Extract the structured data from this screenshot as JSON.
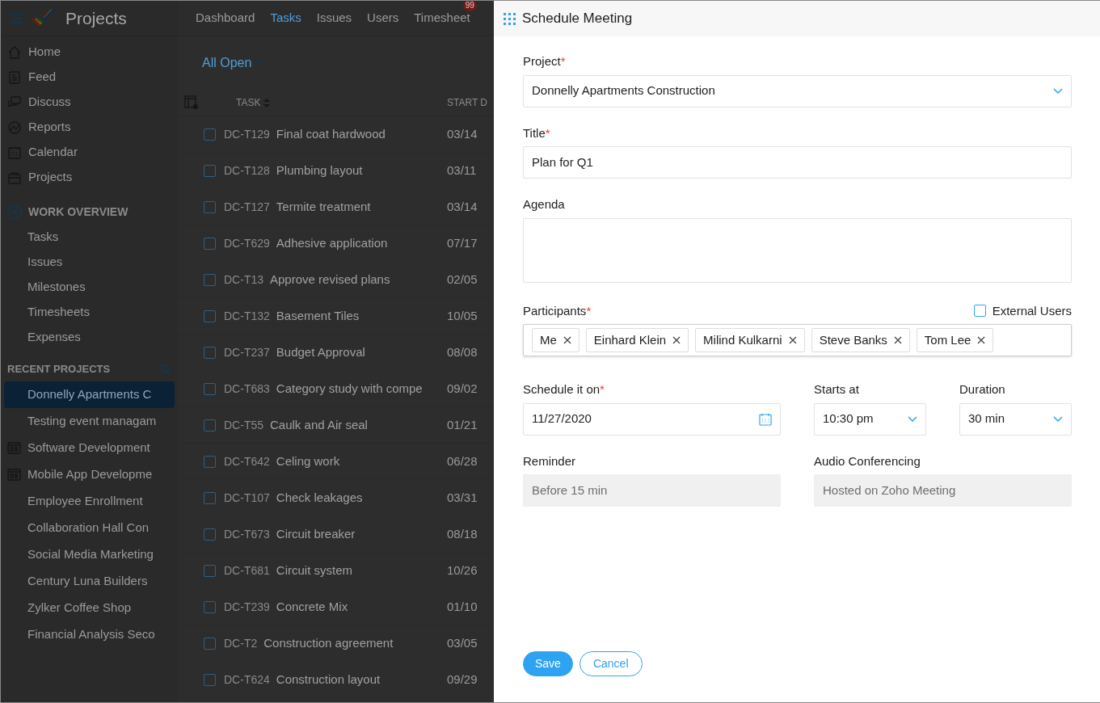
{
  "app": {
    "logo_text": "Projects",
    "nav_tabs": [
      {
        "label": "Dashboard",
        "selected": false
      },
      {
        "label": "Tasks",
        "selected": true
      },
      {
        "label": "Issues",
        "selected": false
      },
      {
        "label": "Users",
        "selected": false
      },
      {
        "label": "Timesheet",
        "selected": false,
        "badge": "99"
      }
    ],
    "sidebar": {
      "items": [
        {
          "label": "Home"
        },
        {
          "label": "Feed"
        },
        {
          "label": "Discuss"
        },
        {
          "label": "Reports"
        },
        {
          "label": "Calendar"
        },
        {
          "label": "Projects"
        }
      ],
      "work_overview": {
        "title": "WORK OVERVIEW",
        "expanded": true,
        "items": [
          {
            "label": "Tasks"
          },
          {
            "label": "Issues"
          },
          {
            "label": "Milestones"
          },
          {
            "label": "Timesheets"
          },
          {
            "label": "Expenses"
          }
        ]
      },
      "recent_projects": {
        "title": "RECENT PROJECTS",
        "items": [
          {
            "label": "Donnelly Apartments C",
            "selected": true,
            "kind": "plain"
          },
          {
            "label": "Testing event managam",
            "selected": false,
            "kind": "plain"
          },
          {
            "label": "Software Development",
            "selected": false,
            "kind": "template"
          },
          {
            "label": "Mobile App Developme",
            "selected": false,
            "kind": "template"
          },
          {
            "label": "Employee Enrollment",
            "selected": false,
            "kind": "plain"
          },
          {
            "label": "Collaboration Hall Con",
            "selected": false,
            "kind": "plain"
          },
          {
            "label": "Social Media Marketing",
            "selected": false,
            "kind": "plain"
          },
          {
            "label": "Century Luna Builders",
            "selected": false,
            "kind": "plain"
          },
          {
            "label": "Zylker Coffee Shop",
            "selected": false,
            "kind": "plain"
          },
          {
            "label": "Financial Analysis Seco",
            "selected": false,
            "kind": "plain"
          }
        ]
      }
    },
    "tasks": {
      "filter": "All Open",
      "columns": [
        "TASK",
        "START D"
      ],
      "rows": [
        {
          "id": "DC-T129",
          "name": "Final coat hardwood",
          "start": "03/14",
          "checked": false
        },
        {
          "id": "DC-T128",
          "name": "Plumbing layout",
          "start": "03/11",
          "checked": false
        },
        {
          "id": "DC-T127",
          "name": "Termite treatment",
          "start": "03/14",
          "checked": false
        },
        {
          "id": "DC-T629",
          "name": "Adhesive application",
          "start": "07/17",
          "checked": false
        },
        {
          "id": "DC-T13",
          "name": "Approve revised plans",
          "start": "02/05",
          "checked": false
        },
        {
          "id": "DC-T132",
          "name": "Basement Tiles",
          "start": "10/05",
          "checked": false
        },
        {
          "id": "DC-T237",
          "name": "Budget Approval",
          "start": "08/08",
          "checked": false
        },
        {
          "id": "DC-T683",
          "name": "Category study with compe",
          "start": "09/02",
          "checked": false
        },
        {
          "id": "DC-T55",
          "name": "Caulk and Air seal",
          "start": "01/21",
          "checked": false
        },
        {
          "id": "DC-T642",
          "name": "Celing work",
          "start": "06/28",
          "checked": false
        },
        {
          "id": "DC-T107",
          "name": "Check leakages",
          "start": "03/31",
          "checked": false
        },
        {
          "id": "DC-T673",
          "name": "Circuit breaker",
          "start": "08/18",
          "checked": false
        },
        {
          "id": "DC-T681",
          "name": "Circuit system",
          "start": "10/26",
          "checked": false
        },
        {
          "id": "DC-T239",
          "name": "Concrete Mix",
          "start": "01/10",
          "checked": false
        },
        {
          "id": "DC-T2",
          "name": "Construction agreement",
          "start": "03/05",
          "checked": false
        },
        {
          "id": "DC-T624",
          "name": "Construction layout",
          "start": "09/29",
          "checked": false
        }
      ]
    }
  },
  "dialog": {
    "title": "Schedule Meeting",
    "project": {
      "label": "Project",
      "required_mark": "*",
      "value": "Donnelly Apartments Construction"
    },
    "title_field": {
      "label": "Title",
      "required_mark": "*",
      "value": "Plan for Q1"
    },
    "agenda": {
      "label": "Agenda"
    },
    "participants": {
      "label": "Participants",
      "required_mark": "*",
      "chips": [
        "Me",
        "Einhard Klein",
        "Milind Kulkarni",
        "Steve Banks",
        "Tom Lee"
      ],
      "external_users": {
        "label": "External Users",
        "checked": false
      }
    },
    "schedule_on": {
      "label": "Schedule it on",
      "required_mark": "*",
      "value": "11/27/2020"
    },
    "starts_at": {
      "label": "Starts at",
      "value": "10:30 pm"
    },
    "duration": {
      "label": "Duration",
      "value": "30 min"
    },
    "reminder": {
      "label": "Reminder",
      "value": "Before 15 min",
      "disabled": true
    },
    "audio_conferencing": {
      "label": "Audio Conferencing",
      "value": "Hosted on Zoho Meeting",
      "disabled": true
    },
    "buttons": [
      {
        "label": "Save",
        "kind": "primary"
      },
      {
        "label": "Cancel",
        "kind": "secondary"
      }
    ]
  }
}
